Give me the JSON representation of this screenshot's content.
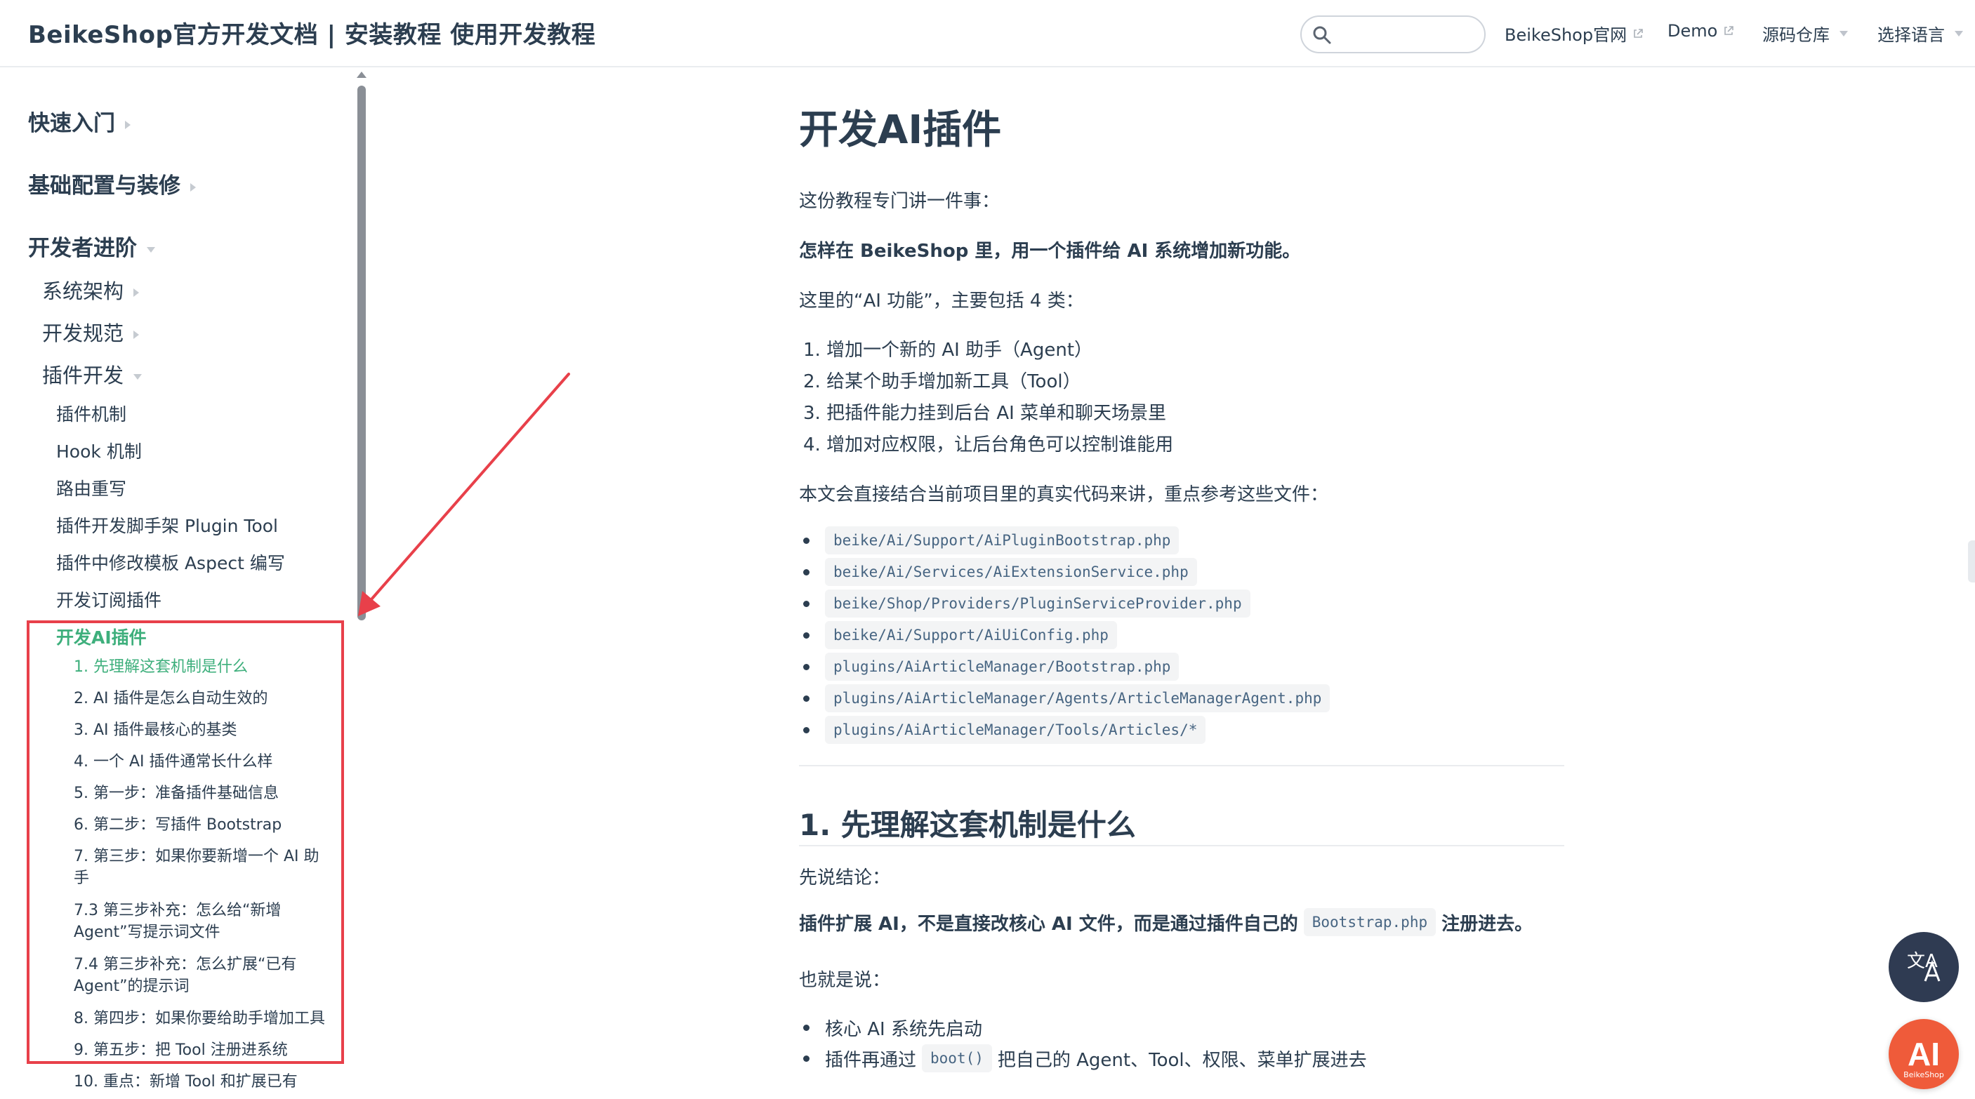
{
  "navbar": {
    "site_title": "BeikeShop官方开发文档 | 安装教程 使用开发教程",
    "search_placeholder": "",
    "links": [
      {
        "label": "BeikeShop官网",
        "external": true
      },
      {
        "label": "Demo",
        "external": true
      },
      {
        "label": "源码仓库",
        "dropdown": true
      },
      {
        "label": "选择语言",
        "dropdown": true
      }
    ]
  },
  "sidebar": {
    "sections": [
      {
        "label": "快速入门",
        "expanded": false
      },
      {
        "label": "基础配置与装修",
        "expanded": false
      },
      {
        "label": "开发者进阶",
        "expanded": true
      }
    ],
    "subsections": [
      {
        "label": "系统架构",
        "expanded": false
      },
      {
        "label": "开发规范",
        "expanded": false
      },
      {
        "label": "插件开发",
        "expanded": true
      }
    ],
    "plugin_pages": [
      "插件机制",
      "Hook 机制",
      "路由重写",
      "插件开发脚手架 Plugin Tool",
      "插件中修改模板 Aspect 编写",
      "开发订阅插件",
      "开发AI插件"
    ],
    "toc": [
      "1. 先理解这套机制是什么",
      "2. AI 插件是怎么自动生效的",
      "3. AI 插件最核心的基类",
      "4. 一个 AI 插件通常长什么样",
      "5. 第一步：准备插件基础信息",
      "6. 第二步：写插件 Bootstrap",
      "7. 第三步：如果你要新增一个 AI 助手",
      "7.3 第三步补充：怎么给“新增 Agent”写提示词文件",
      "7.4 第三步补充：怎么扩展“已有 Agent”的提示词",
      "8. 第四步：如果你要给助手增加工具",
      "9. 第五步：把 Tool 注册进系统",
      "10. 重点：新增 Tool 和扩展已有"
    ]
  },
  "content": {
    "title": "开发AI插件",
    "intro": "这份教程专门讲一件事：",
    "intro_bold": "怎样在 BeikeShop 里，用一个插件给 AI 系统增加新功能。",
    "features_intro": "这里的“AI 功能”，主要包括 4 类：",
    "features": [
      "1. 增加一个新的 AI 助手（Agent）",
      "2. 给某个助手增加新工具（Tool）",
      "3. 把插件能力挂到后台 AI 菜单和聊天场景里",
      "4. 增加对应权限，让后台角色可以控制谁能用"
    ],
    "files_intro": "本文会直接结合当前项目里的真实代码来讲，重点参考这些文件：",
    "files": [
      "beike/Ai/Support/AiPluginBootstrap.php",
      "beike/Ai/Services/AiExtensionService.php",
      "beike/Shop/Providers/PluginServiceProvider.php",
      "beike/Ai/Support/AiUiConfig.php",
      "plugins/AiArticleManager/Bootstrap.php",
      "plugins/AiArticleManager/Agents/ArticleManagerAgent.php",
      "plugins/AiArticleManager/Tools/Articles/*"
    ],
    "section1_title": "1. 先理解这套机制是什么",
    "conclusion_label": "先说结论：",
    "conclusion_pre": "插件扩展 AI，不是直接改核心 AI 文件，而是通过插件自己的",
    "conclusion_code": "Bootstrap.php",
    "conclusion_post": "注册进去。",
    "that_is": "也就是说：",
    "bullets": [
      {
        "pre": "核心 AI 系统先启动",
        "code": "",
        "post": ""
      },
      {
        "pre": "插件再通过",
        "code": "boot()",
        "post": "把自己的 Agent、Tool、权限、菜单扩展进去"
      }
    ]
  },
  "floating": {
    "translate_glyph": "文A",
    "ai_label": "AI",
    "ai_brand": "BeikeShop"
  },
  "colors": {
    "accent": "#3eaf7c",
    "text": "#2c3e50",
    "annotation": "#e8404a",
    "code_text": "#476582",
    "code_bg": "#f3f4f5"
  }
}
